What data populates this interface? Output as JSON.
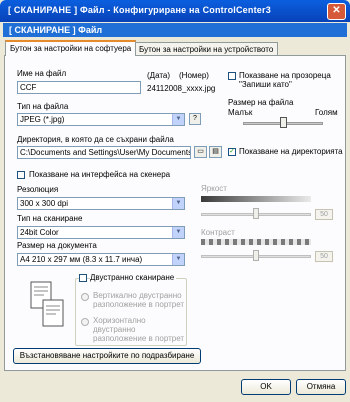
{
  "window": {
    "title": "[ СКАНИРАНЕ ]   Файл - Конфигуриране на ControlCenter3",
    "close": "✕",
    "header": "[ СКАНИРАНЕ ]   Файл"
  },
  "tabs": [
    {
      "label": "Бутон за настройки на софтуера",
      "active": true
    },
    {
      "label": "Бутон за настройки на устройството",
      "active": false
    }
  ],
  "file": {
    "name_label": "Име на файл",
    "name_value": "CCF",
    "date_label": "(Дата)",
    "number_label": "(Номер)",
    "sample": "24112008_xxxx.jpg",
    "show_saveas_label": "Показване на прозореца \"Запиши като\"",
    "type_label": "Тип на файла",
    "type_value": "JPEG (*.jpg)",
    "size_label": "Размер на файла",
    "size_small": "Малък",
    "size_large": "Голям",
    "dir_label": "Директория, в която да се съхрани файла",
    "dir_value": "C:\\Documents and Settings\\User\\My Documents\\My",
    "show_dir_label": "Показване на директорията",
    "show_dir_checked": "✓"
  },
  "scanner": {
    "show_interface_label": "Показване на интерфейса на скенера",
    "resolution_label": "Резолюция",
    "resolution_value": "300 x 300 dpi",
    "scan_type_label": "Тип на сканиране",
    "scan_type_value": "24bit Color",
    "doc_size_label": "Размер на документа",
    "doc_size_value": "A4 210 x 297 мм (8.3 x 11.7 инча)",
    "brightness_label": "Яркост",
    "brightness_value": "50",
    "contrast_label": "Контраст",
    "contrast_value": "50",
    "duplex_label": "Двустранно сканиране",
    "duplex_long": "Вертикално двустранно разположение в портрет",
    "duplex_short": "Хоризонтално двустранно разположение в портрет"
  },
  "buttons": {
    "restore": "Възстановяване настройките по подразбиране",
    "ok": "OK",
    "cancel": "Отмяна"
  }
}
